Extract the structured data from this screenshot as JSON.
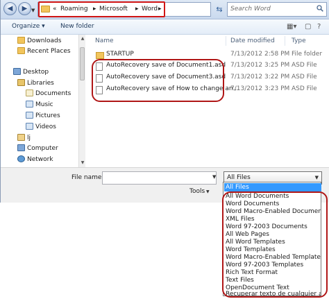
{
  "address_bar": {
    "crumbs": [
      "«",
      "Roaming",
      "▸",
      "Microsoft",
      "▸",
      "Word",
      "▸"
    ],
    "search_placeholder": "Search Word"
  },
  "toolbar": {
    "organize_label": "Organize ▾",
    "new_folder_label": "New folder"
  },
  "nav_pane": {
    "items": [
      {
        "label": "Downloads",
        "icon": "folder-icon"
      },
      {
        "label": "Recent Places",
        "icon": "recent-places-icon"
      },
      {
        "label": "Desktop",
        "icon": "desktop-icon"
      },
      {
        "label": "Libraries",
        "icon": "libraries-icon"
      },
      {
        "label": "Documents",
        "icon": "documents-icon"
      },
      {
        "label": "Music",
        "icon": "music-icon"
      },
      {
        "label": "Pictures",
        "icon": "pictures-icon"
      },
      {
        "label": "Videos",
        "icon": "videos-icon"
      },
      {
        "label": "lj",
        "icon": "user-icon"
      },
      {
        "label": "Computer",
        "icon": "computer-icon"
      },
      {
        "label": "Network",
        "icon": "network-icon"
      }
    ]
  },
  "file_list": {
    "columns": [
      "Name",
      "Date modified",
      "Type"
    ],
    "rows": [
      {
        "name": "STARTUP",
        "date": "7/13/2012 2:58 PM",
        "type": "File folder",
        "icon": "folder-icon"
      },
      {
        "name": "AutoRecovery save of Document1.asd",
        "date": "7/13/2012 3:25 PM",
        "type": "ASD File",
        "icon": "asd-file-icon"
      },
      {
        "name": "AutoRecovery save of Document3.asd",
        "date": "7/13/2012 3:22 PM",
        "type": "ASD File",
        "icon": "asd-file-icon"
      },
      {
        "name": "AutoRecovery save of How to change an...",
        "date": "7/13/2012 3:23 PM",
        "type": "ASD File",
        "icon": "asd-file-icon"
      }
    ]
  },
  "bottom": {
    "file_name_label": "File name:",
    "file_name_value": "",
    "file_type_value": "All Files",
    "tools_label": "Tools"
  },
  "file_type_options": [
    "All Files",
    "All Word Documents",
    "Word Documents",
    "Word Macro-Enabled Documents",
    "XML Files",
    "Word 97-2003 Documents",
    "All Web Pages",
    "All Word Templates",
    "Word Templates",
    "Word Macro-Enabled Templates",
    "Word 97-2003 Templates",
    "Rich Text Format",
    "Text Files",
    "OpenDocument Text",
    "Recuperar texto de cualquier archivo"
  ],
  "colors": {
    "highlight_red": "#b01616",
    "selection_blue": "#3399ff"
  }
}
